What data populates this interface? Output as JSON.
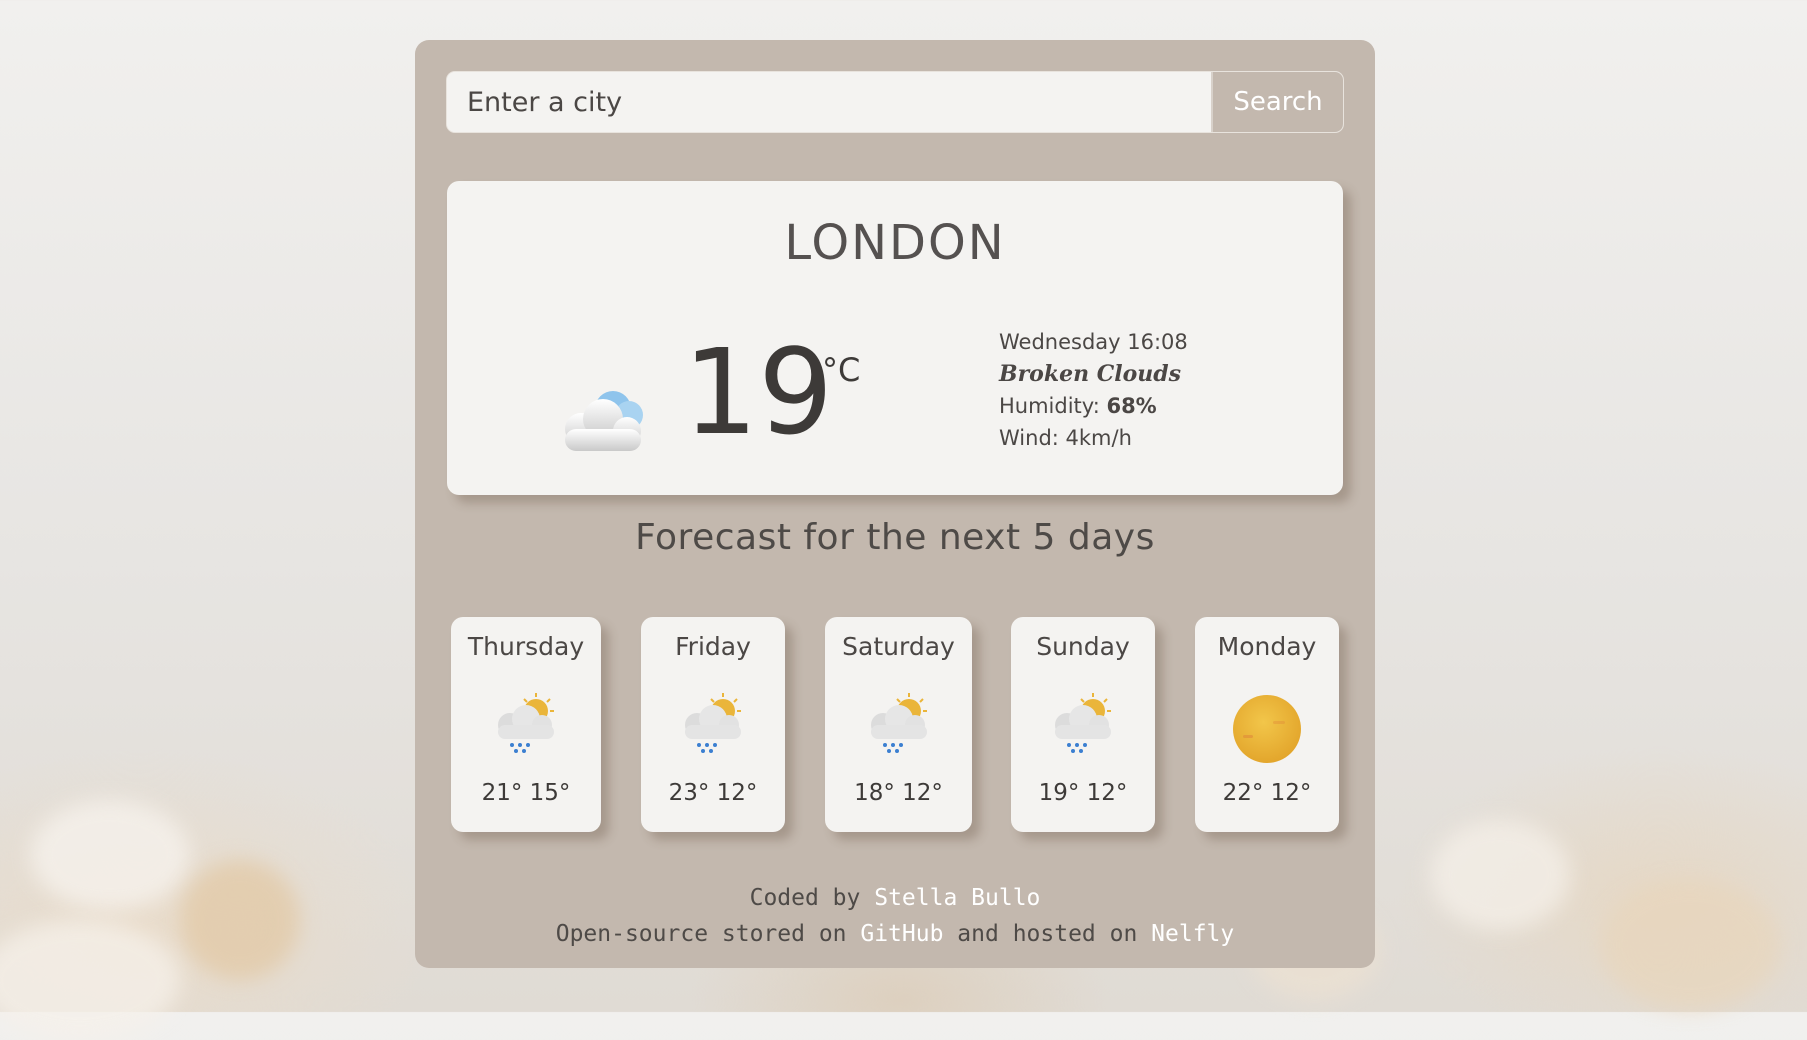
{
  "search": {
    "placeholder": "Enter a city",
    "button_label": "Search"
  },
  "current": {
    "city": "LONDON",
    "icon": "broken-clouds-icon",
    "temperature": "19",
    "unit": "°C",
    "datetime": "Wednesday 16:08",
    "description": "Broken Clouds",
    "humidity_label": "Humidity: ",
    "humidity_value": "68%",
    "wind": "Wind: 4km/h"
  },
  "forecast": {
    "title": "Forecast for the next 5 days",
    "days": [
      {
        "name": "Thursday",
        "icon": "rain-sun-icon",
        "temps": "21° 15°"
      },
      {
        "name": "Friday",
        "icon": "rain-sun-icon",
        "temps": "23° 12°"
      },
      {
        "name": "Saturday",
        "icon": "rain-sun-icon",
        "temps": "18° 12°"
      },
      {
        "name": "Sunday",
        "icon": "rain-sun-icon",
        "temps": "19° 12°"
      },
      {
        "name": "Monday",
        "icon": "sun-icon",
        "temps": "22° 12°"
      }
    ]
  },
  "footer": {
    "coded_by": "Coded by ",
    "author": "Stella Bullo",
    "line2_prefix": "Open-source stored on ",
    "github": "GitHub",
    "line2_middle": " and hosted on ",
    "host": "Nelfly"
  },
  "colors": {
    "panel": "#c3b8ae",
    "card": "#f4f3f1",
    "text": "#4b4745",
    "link": "#ffffff"
  }
}
